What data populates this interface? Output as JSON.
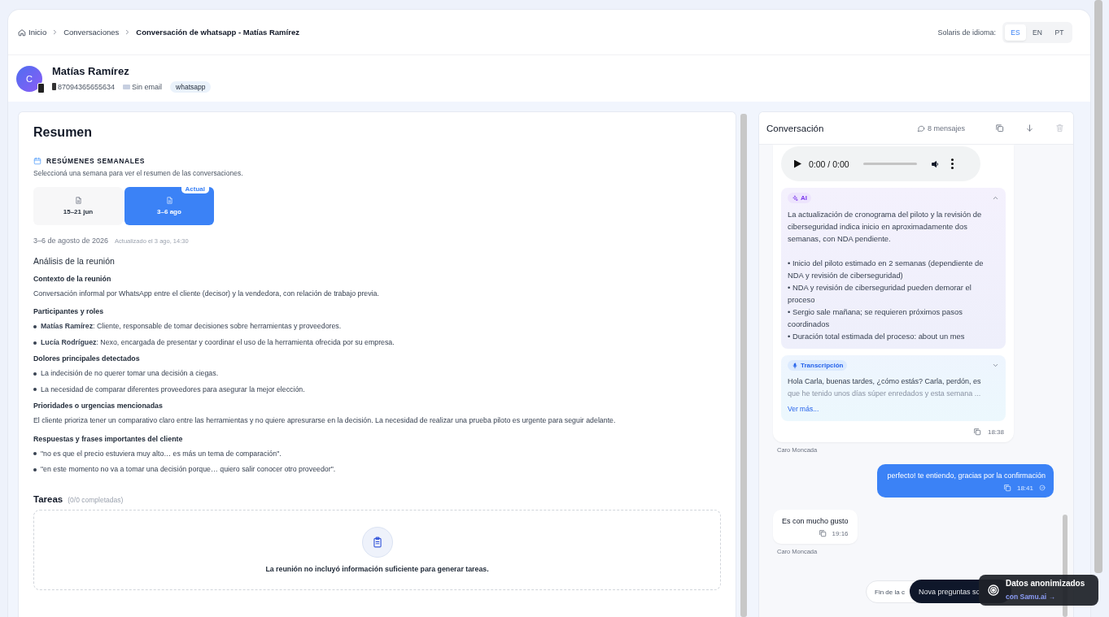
{
  "breadcrumb": [
    {
      "label": "Inicio"
    },
    {
      "label": "Conversaciones"
    },
    {
      "label": "Conversación de whatsapp - Matías Ramírez"
    }
  ],
  "language": {
    "label": "Solaris de idioma:",
    "options": [
      {
        "label": "ES",
        "selected": true
      },
      {
        "label": "EN",
        "selected": false
      },
      {
        "label": "PT",
        "selected": false
      }
    ]
  },
  "contact": {
    "initial": "C",
    "name": "Matías Ramírez",
    "phone": "87094365655634",
    "email": "Sin email",
    "channel": "whatsapp"
  },
  "summary": {
    "title": "Resumen",
    "weekly_heading": "RESÚMENES SEMANALES",
    "weekly_hint": "Seleccioná una semana para ver el resumen de las conversaciones.",
    "weeks": [
      {
        "label": "15–21 jun",
        "selected": false
      },
      {
        "label": "3–6 ago",
        "selected": true,
        "badge": "Actual"
      }
    ],
    "date": "3–6 de agosto de 2026",
    "updated": "Actualizado el 3 ago, 14:30",
    "analysis_title": "Análisis de la reunión",
    "sections": [
      {
        "title": "Contexto de la reunión",
        "kind": "paragraph",
        "text": "Conversación informal por WhatsApp entre el cliente (decisor) y la vendedora, con relación de trabajo previa."
      },
      {
        "title": "Participantes y roles",
        "kind": "list",
        "items": [
          "**Matías Ramírez**: Cliente, responsable de tomar decisiones sobre herramientas y proveedores.",
          "**Lucía Rodríguez**: Nexo, encargada de presentar y coordinar el uso de la herramienta ofrecida por su empresa."
        ]
      },
      {
        "title": "Dolores principales detectados",
        "kind": "list",
        "items": [
          "La indecisión de no querer tomar una decisión a ciegas.",
          "La necesidad de comparar diferentes proveedores para asegurar la mejor elección."
        ]
      },
      {
        "title": "Prioridades o urgencias mencionadas",
        "kind": "paragraph",
        "text": "El cliente prioriza tener un comparativo claro entre las herramientas y no quiere apresurarse en la decisión. La necesidad de realizar una prueba piloto es urgente para seguir adelante."
      },
      {
        "title": "Respuestas y frases importantes del cliente",
        "kind": "list",
        "items": [
          "\"no es que el precio estuviera muy alto… es más un tema de comparación\".",
          "\"en este momento no va a tomar una decisión porque… quiero salir conocer otro proveedor\"."
        ]
      }
    ],
    "tasks": {
      "title": "Tareas",
      "count": "(0/0 completadas)",
      "empty": "La reunión no incluyó información suficiente para generar tareas."
    }
  },
  "conversation": {
    "title": "Conversación",
    "count": "8 mensajes",
    "audio": {
      "time": "0:00 / 0:00"
    },
    "ai": {
      "label": "AI",
      "expanded": true,
      "summary": "La actualización de cronograma del piloto y la revisión de ciberseguridad indica inicio en aproximadamente dos semanas, con NDA pendiente.",
      "bullets": [
        "• Inicio del piloto estimado en 2 semanas (dependiente de NDA y revisión de ciberseguridad)",
        "• NDA y revisión de ciberseguridad pueden demorar el proceso",
        "• Sergio sale mañana; se requieren próximos pasos coordinados",
        "• Duración total estimada del proceso: about un mes"
      ]
    },
    "transcript": {
      "label": "Transcripción",
      "expanded": false,
      "text": "Hola Carla, buenas tardes, ¿cómo estás? Carla, perdón, es",
      "faded": "que he tenido unos días súper enredados y esta semana ...",
      "more": "Ver más..."
    },
    "first_time": "18:38",
    "first_sender": "Caro Moncada",
    "messages": [
      {
        "kind": "outgoing",
        "text": "perfecto! te entiendo, gracias por la confirmación",
        "time": "18:41"
      },
      {
        "kind": "incoming",
        "text": "Es con mucho gusto",
        "time": "19:16",
        "sender": "Caro Moncada"
      }
    ]
  },
  "end_pill": "Fin de la c",
  "ask_pill": "Nova preguntas so",
  "toast": {
    "title": "Datos anonimizados",
    "link": "con Samu.ai →"
  }
}
